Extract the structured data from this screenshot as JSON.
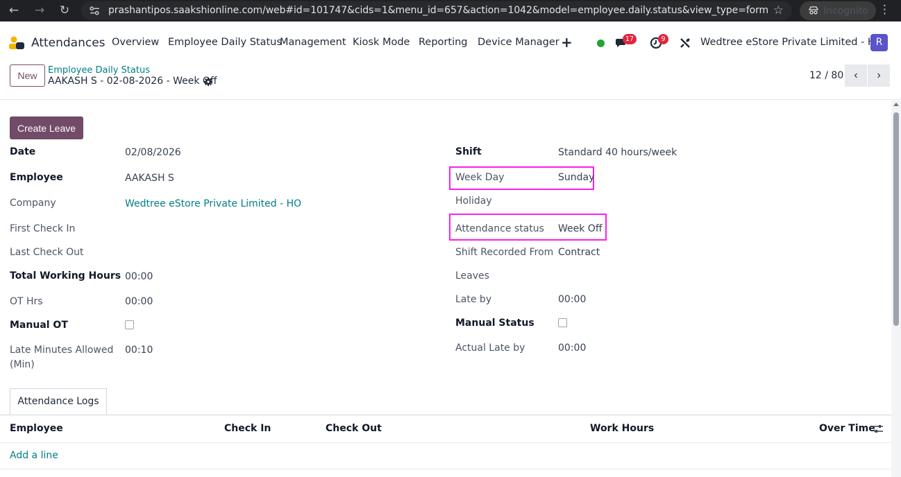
{
  "browser": {
    "url": "prashantipos.saakshionline.com/web#id=101747&cids=1&menu_id=657&action=1042&model=employee.daily.status&view_type=form",
    "incognito_label": "Incognito"
  },
  "navbar": {
    "app_name": "Attendances",
    "menu": [
      "Overview",
      "Employee Daily Status",
      "Management",
      "Kiosk Mode",
      "Reporting",
      "Device Manager"
    ],
    "chat_count": "17",
    "activity_count": "9",
    "company": "Wedtree eStore Private Limited - HO",
    "avatar_initial": "R"
  },
  "control": {
    "new_label": "New",
    "breadcrumb": "Employee Daily Status",
    "record_title": "AAKASH S - 02-08-2026 - Week Off",
    "pager": "12 / 80"
  },
  "form": {
    "create_leave_label": "Create Leave",
    "left": {
      "date_label": "Date",
      "date_value": "02/08/2026",
      "employee_label": "Employee",
      "employee_value": "AAKASH S",
      "company_label": "Company",
      "company_value": "Wedtree eStore Private Limited - HO",
      "first_check_in_label": "First Check In",
      "last_check_out_label": "Last Check Out",
      "total_working_hours_label": "Total Working Hours",
      "total_working_hours_value": "00:00",
      "ot_hrs_label": "OT Hrs",
      "ot_hrs_value": "00:00",
      "manual_ot_label": "Manual OT",
      "late_minutes_label_1": "Late Minutes Allowed",
      "late_minutes_label_2": "(Min)",
      "late_minutes_value": "00:10"
    },
    "right": {
      "shift_label": "Shift",
      "shift_value": "Standard 40 hours/week",
      "week_day_label": "Week Day",
      "week_day_value": "Sunday",
      "holiday_label": "Holiday",
      "attendance_status_label": "Attendance status",
      "attendance_status_value": "Week Off",
      "shift_recorded_label": "Shift Recorded From",
      "shift_recorded_value": "Contract",
      "leaves_label": "Leaves",
      "late_by_label": "Late by",
      "late_by_value": "00:00",
      "manual_status_label": "Manual Status",
      "actual_late_label": "Actual Late by",
      "actual_late_value": "00:00"
    },
    "tab_label": "Attendance Logs",
    "table": {
      "headers": [
        "Employee",
        "Check In",
        "Check Out",
        "Work Hours",
        "Over Time"
      ],
      "add_line": "Add a line"
    }
  },
  "colors": {
    "brand": "#714b67",
    "link": "#017e84",
    "highlight": "#ff1cf1"
  }
}
